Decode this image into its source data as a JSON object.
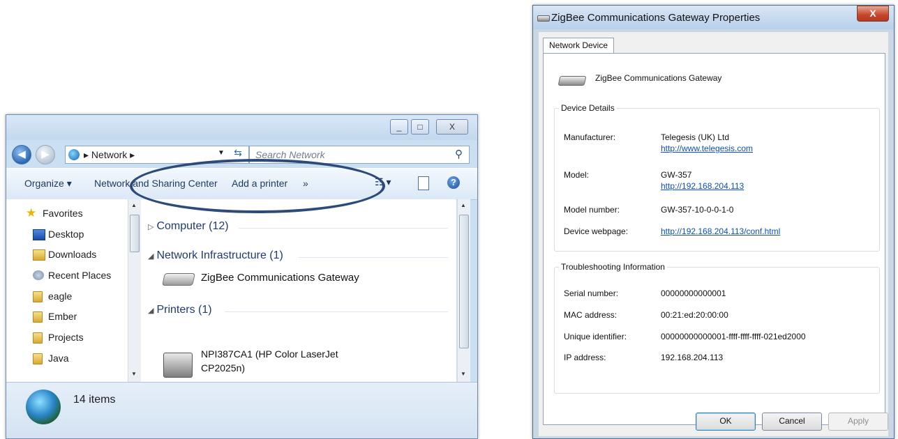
{
  "explorer": {
    "window_controls": {
      "minimize": "_",
      "maximize": "□",
      "close": "X"
    },
    "address": {
      "location": "Network",
      "search_placeholder": "Search Network"
    },
    "toolbar": {
      "organize": "Organize ▾",
      "network_sharing": "Network and Sharing Center",
      "add_printer": "Add a printer",
      "more": "»"
    },
    "nav_items": [
      {
        "label": "Favorites",
        "icon": "star-icon"
      },
      {
        "label": "Desktop",
        "icon": "desktop-icon"
      },
      {
        "label": "Downloads",
        "icon": "downloads-folder-icon"
      },
      {
        "label": "Recent Places",
        "icon": "recent-places-icon"
      },
      {
        "label": "eagle",
        "icon": "folder-icon"
      },
      {
        "label": "Ember",
        "icon": "folder-icon"
      },
      {
        "label": "Projects",
        "icon": "folder-icon"
      },
      {
        "label": "Java",
        "icon": "folder-icon"
      }
    ],
    "groups": [
      {
        "label": "Computer (12)",
        "expanded": false
      },
      {
        "label": "Network Infrastructure (1)",
        "expanded": true
      },
      {
        "label": "Printers (1)",
        "expanded": true
      }
    ],
    "gateway_item": "ZigBee Communications Gateway",
    "printer_item": "NPI387CA1 (HP Color LaserJet CP2025n)",
    "status": "14 items"
  },
  "dialog": {
    "title": "ZigBee Communications Gateway Properties",
    "close": "X",
    "tab": "Network Device",
    "device_name": "ZigBee Communications Gateway",
    "details": {
      "title": "Device Details",
      "manufacturer_label": "Manufacturer:",
      "manufacturer": "Telegesis (UK) Ltd",
      "manufacturer_url": "http://www.telegesis.com",
      "model_label": "Model:",
      "model": "GW-357",
      "model_url": "http://192.168.204.113",
      "model_number_label": "Model number:",
      "model_number": "GW-357-10-0-0-1-0",
      "webpage_label": "Device webpage:",
      "webpage": "http://192.168.204.113/conf.html"
    },
    "troubleshooting": {
      "title": "Troubleshooting Information",
      "serial_label": "Serial number:",
      "serial": "00000000000001",
      "mac_label": "MAC address:",
      "mac": "00:21:ed:20:00:00",
      "uid_label": "Unique identifier:",
      "uid": "00000000000001-ffff-ffff-ffff-021ed2000",
      "ip_label": "IP address:",
      "ip": "192.168.204.113"
    },
    "buttons": {
      "ok": "OK",
      "cancel": "Cancel",
      "apply": "Apply"
    }
  }
}
